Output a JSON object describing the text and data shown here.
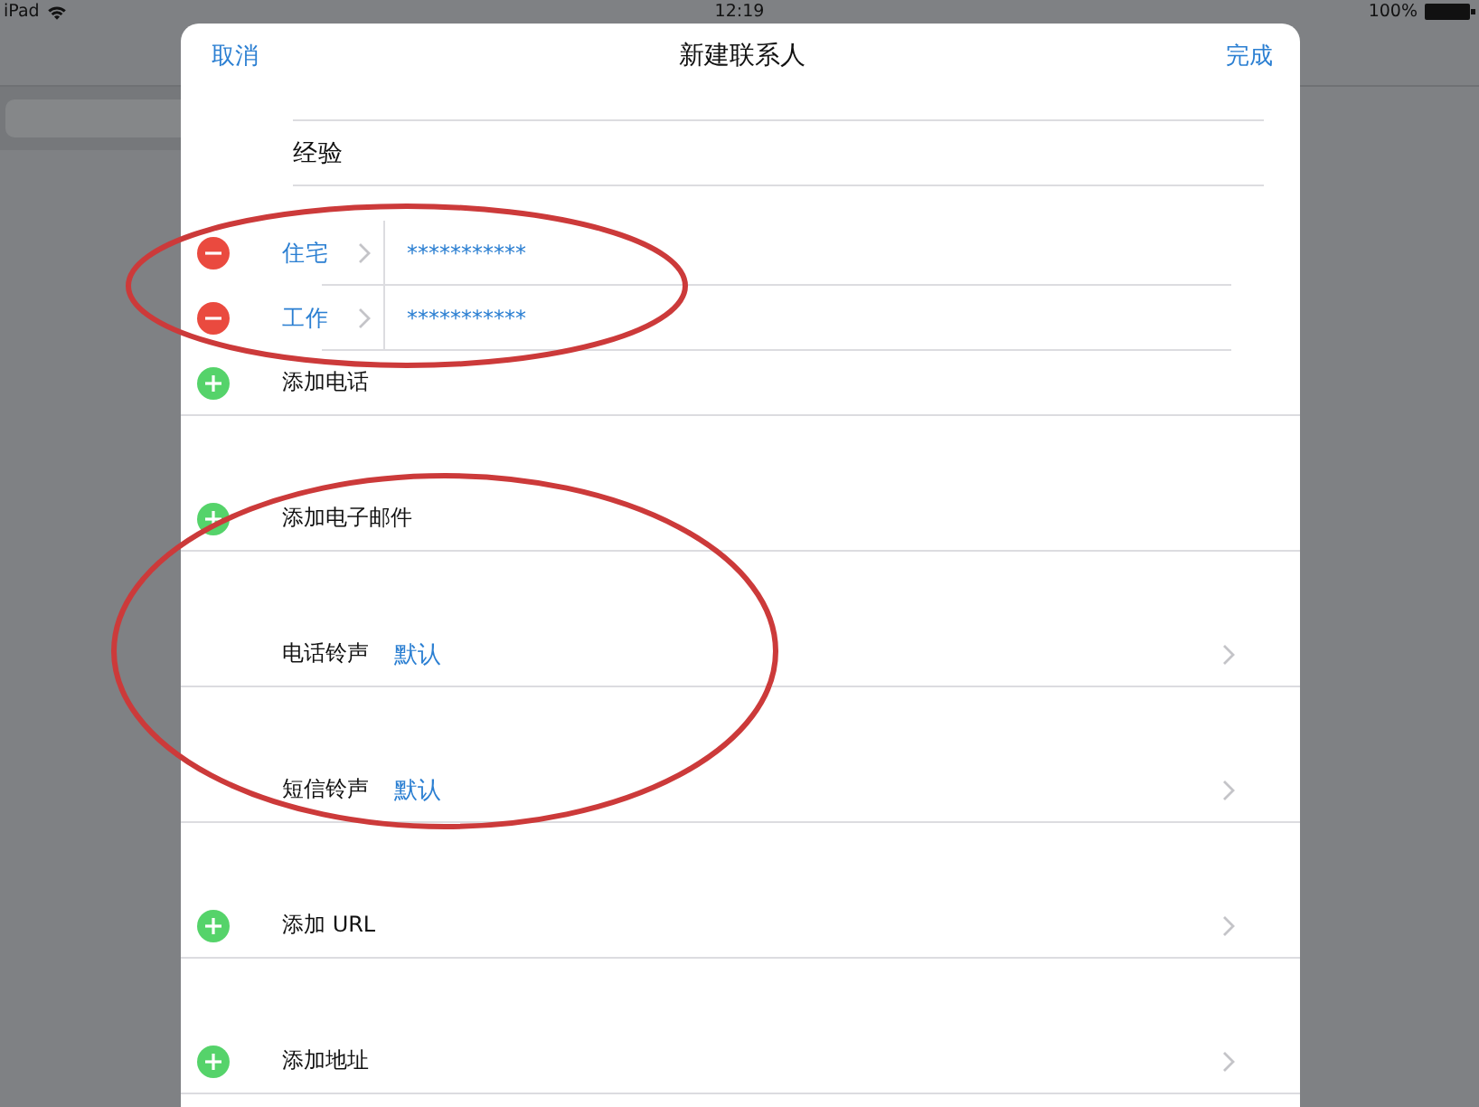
{
  "status_bar": {
    "device": "iPad",
    "time": "12:19",
    "battery": "100%"
  },
  "sheet": {
    "cancel": "取消",
    "title": "新建联系人",
    "done": "完成"
  },
  "sections": [
    {
      "rows": [
        {
          "kind": "field",
          "value": "经验"
        }
      ]
    },
    {
      "rows": [
        {
          "kind": "phone",
          "label": "住宅",
          "value": "***********"
        },
        {
          "kind": "phone",
          "label": "工作",
          "value": "***********"
        },
        {
          "kind": "add",
          "label": "添加电话",
          "chevron": false
        }
      ]
    },
    {
      "rows": [
        {
          "kind": "add",
          "label": "添加电子邮件",
          "chevron": false
        }
      ]
    },
    {
      "rows": [
        {
          "kind": "setting",
          "label": "电话铃声",
          "value": "默认",
          "chevron": true
        }
      ]
    },
    {
      "rows": [
        {
          "kind": "setting",
          "label": "短信铃声",
          "value": "默认",
          "chevron": true
        }
      ]
    },
    {
      "rows": [
        {
          "kind": "add",
          "label": "添加 URL",
          "chevron": true
        }
      ]
    },
    {
      "rows": [
        {
          "kind": "add",
          "label": "添加地址",
          "chevron": true
        }
      ]
    }
  ],
  "annotations": [
    {
      "kind": "ellipse"
    },
    {
      "kind": "ellipse"
    }
  ]
}
